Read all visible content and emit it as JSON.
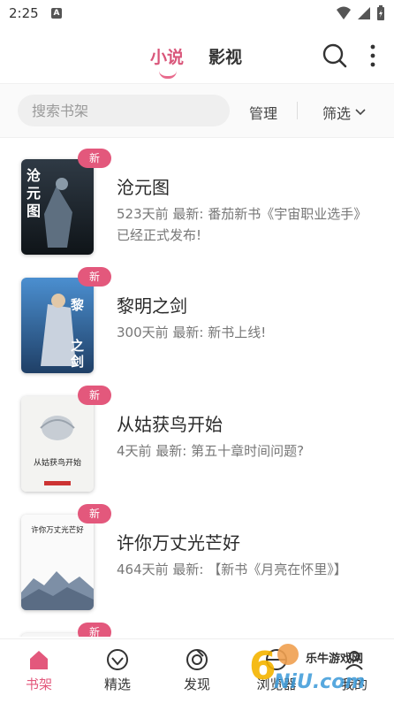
{
  "status_bar": {
    "time": "2:25",
    "notification_letter": "A"
  },
  "header": {
    "tabs": [
      {
        "label": "小说",
        "active": true
      },
      {
        "label": "影视",
        "active": false
      }
    ],
    "accent_color": "#e3587c",
    "search_icon": "search-icon",
    "more_icon": "more-vertical-icon"
  },
  "toolbar": {
    "search_placeholder": "搜索书架",
    "manage_label": "管理",
    "filter_label": "筛选"
  },
  "books": [
    {
      "title": "沧元图",
      "badge": "新",
      "latest": "523天前 最新: 番茄新书《宇宙职业选手》已经正式发布!",
      "cover_text": "沧元图"
    },
    {
      "title": "黎明之剑",
      "badge": "新",
      "latest": "300天前 最新: 新书上线!",
      "cover_text": "黎明之剑"
    },
    {
      "title": "从姑获鸟开始",
      "badge": "新",
      "latest": "4天前 最新: 第五十章时间问题?",
      "cover_text": "从姑获鸟开始"
    },
    {
      "title": "许你万丈光芒好",
      "badge": "新",
      "latest": "464天前 最新: 【新书《月亮在怀里》】",
      "cover_text": "许你万丈光芒好"
    },
    {
      "title": "",
      "badge": "新",
      "latest": "",
      "cover_text": ""
    }
  ],
  "bottom_nav": [
    {
      "label": "书架",
      "icon": "home-icon",
      "active": true
    },
    {
      "label": "精选",
      "icon": "diamond-icon",
      "active": false
    },
    {
      "label": "发现",
      "icon": "compass-icon",
      "active": false
    },
    {
      "label": "浏览器",
      "icon": "browser-icon",
      "active": false
    },
    {
      "label": "我的",
      "icon": "user-icon",
      "active": false
    }
  ],
  "watermark": {
    "text": "乐牛游戏网"
  }
}
